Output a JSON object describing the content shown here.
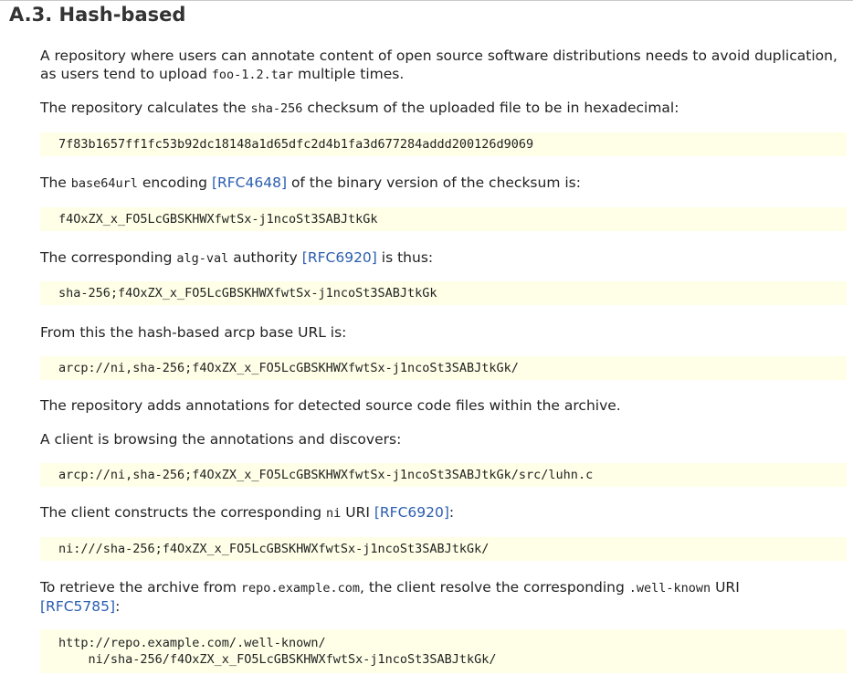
{
  "heading": "A.3. Hash-based",
  "p1": {
    "t1": "A repository where users can annotate content of open source software distributions needs to avoid duplication, as users tend to upload ",
    "code": "foo-1.2.tar",
    "t2": " multiple times."
  },
  "p2": {
    "t1": "The repository calculates the ",
    "code": "sha-256",
    "t2": " checksum of the uploaded file to be in hexadecimal:"
  },
  "cb1": "7f83b1657ff1fc53b92dc18148a1d65dfc2d4b1fa3d677284addd200126d9069",
  "p3": {
    "t1": "The ",
    "code": "base64url",
    "t2": " encoding ",
    "link": "[RFC4648]",
    "t3": " of the binary version of the checksum is:"
  },
  "cb2": "f4OxZX_x_FO5LcGBSKHWXfwtSx-j1ncoSt3SABJtkGk",
  "p4": {
    "t1": "The corresponding ",
    "code": "alg-val",
    "t2": " authority ",
    "link": "[RFC6920]",
    "t3": " is thus:"
  },
  "cb3": "sha-256;f4OxZX_x_FO5LcGBSKHWXfwtSx-j1ncoSt3SABJtkGk",
  "p5": "From this the hash-based arcp base URL is:",
  "cb4": "arcp://ni,sha-256;f4OxZX_x_FO5LcGBSKHWXfwtSx-j1ncoSt3SABJtkGk/",
  "p6": "The repository adds annotations for detected source code files within the archive.",
  "p7": "A client is browsing the annotations and discovers:",
  "cb5": "arcp://ni,sha-256;f4OxZX_x_FO5LcGBSKHWXfwtSx-j1ncoSt3SABJtkGk/src/luhn.c",
  "p8": {
    "t1": "The client constructs the corresponding ",
    "code": "ni",
    "t2": " URI ",
    "link": "[RFC6920]",
    "t3": ":"
  },
  "cb6": "ni:///sha-256;f4OxZX_x_FO5LcGBSKHWXfwtSx-j1ncoSt3SABJtkGk/",
  "p9": {
    "t1": "To retrieve the archive from ",
    "code1": "repo.example.com",
    "t2": ", the client resolve the corresponding ",
    "code2": ".well-known",
    "t3": " URI",
    "link": "[RFC5785]",
    "t4": ":"
  },
  "cb7": {
    "line1": "http://repo.example.com/.well-known/",
    "line2": "    ni/sha-256/f4OxZX_x_FO5LcGBSKHWXfwtSx-j1ncoSt3SABJtkGk/"
  }
}
